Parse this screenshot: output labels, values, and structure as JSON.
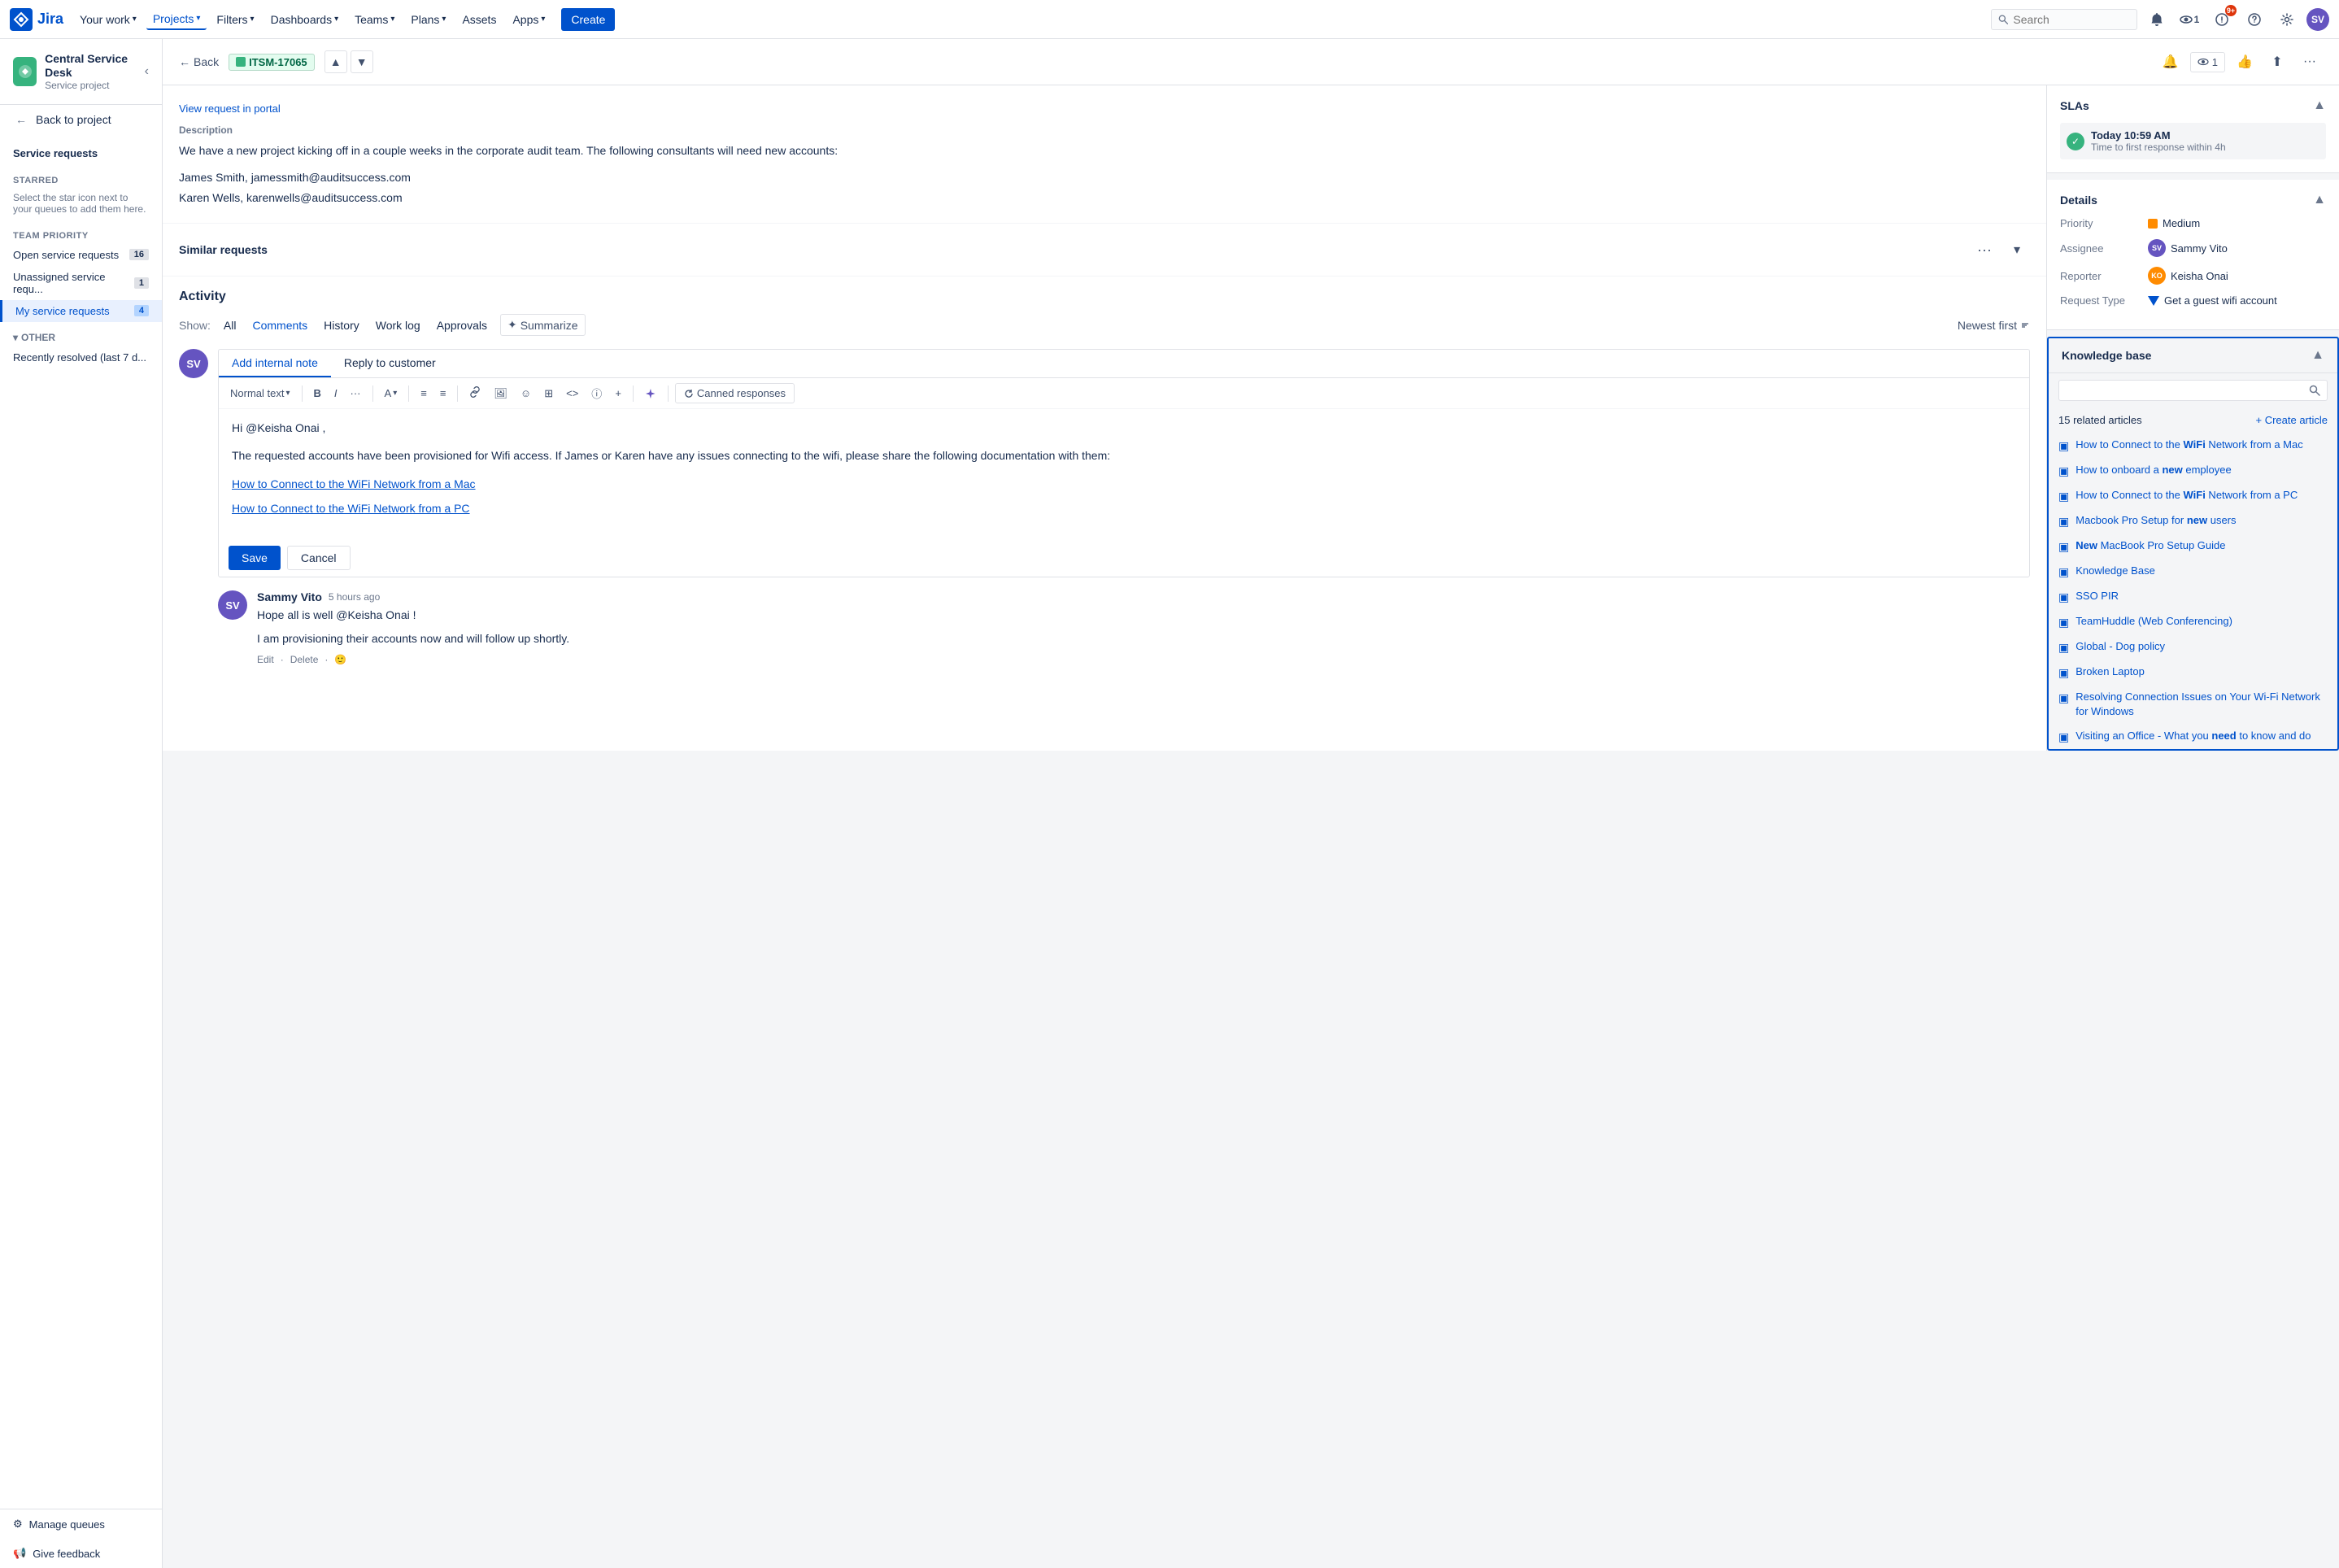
{
  "topNav": {
    "logo": "J",
    "logoText": "Jira",
    "yourWork": "Your work",
    "projects": "Projects",
    "filters": "Filters",
    "dashboards": "Dashboards",
    "teams": "Teams",
    "plans": "Plans",
    "assets": "Assets",
    "apps": "Apps",
    "createBtn": "Create",
    "search": {
      "placeholder": "Search"
    },
    "notifCount": "9+"
  },
  "sidebar": {
    "projectName": "Central Service Desk",
    "projectType": "Service project",
    "backToProject": "Back to project",
    "serviceRequests": "Service requests",
    "starred": "STARRED",
    "starredHint": "Select the star icon next to your queues to add them here.",
    "teamPriority": "TEAM PRIORITY",
    "queues": [
      {
        "label": "Open service requests",
        "count": "16"
      },
      {
        "label": "Unassigned service requ...",
        "count": "1"
      },
      {
        "label": "My service requests",
        "count": "4",
        "active": true
      }
    ],
    "other": "OTHER",
    "otherItems": [
      {
        "label": "Recently resolved (last 7 d..."
      }
    ],
    "bottom": [
      {
        "label": "Manage queues",
        "icon": "⚙"
      },
      {
        "label": "Give feedback",
        "icon": "📢"
      }
    ]
  },
  "ticketHeader": {
    "back": "Back",
    "ticketId": "ITSM-17065"
  },
  "description": {
    "viewPortal": "View request in portal",
    "label": "Description",
    "text1": "We have a new project kicking off in a couple weeks in the corporate audit team. The following consultants will need new accounts:",
    "consultant1": "James Smith, jamessmith@auditsuccess.com",
    "consultant2": "Karen Wells, karenwells@auditsuccess.com"
  },
  "similarRequests": {
    "title": "Similar requests"
  },
  "activity": {
    "title": "Activity",
    "showLabel": "Show:",
    "filters": [
      "All",
      "Comments",
      "History",
      "Work log",
      "Approvals"
    ],
    "activeFilter": "Comments",
    "summarize": "Summarize",
    "newestFirst": "Newest first"
  },
  "editor": {
    "tabs": [
      "Add internal note",
      "Reply to customer"
    ],
    "activeTab": "Add internal note",
    "toolbar": {
      "textStyle": "Normal text",
      "bold": "B",
      "italic": "I",
      "more": "···",
      "textColor": "A",
      "bulletList": "≡",
      "numberedList": "≡",
      "link": "🔗",
      "image": "🖼",
      "emoji": "☺",
      "table": "⊞",
      "code": "<>",
      "info": "ⓘ",
      "plus": "+",
      "aiSparkle": "✦",
      "cannedBtn": "Canned responses"
    },
    "content": {
      "greeting": "Hi @Keisha Onai ,",
      "body1": "The requested accounts have been provisioned for Wifi access. If James or Karen have any issues connecting to the wifi, please share the following documentation with them:",
      "link1": "How to Connect to the WiFi Network from a Mac",
      "link2": "How to Connect to the WiFi Network from a PC"
    },
    "saveBtn": "Save",
    "cancelBtn": "Cancel"
  },
  "pastComment": {
    "authorInitials": "SV",
    "author": "Sammy Vito",
    "time": "5 hours ago",
    "text1": "Hope all is well @Keisha Onai !",
    "text2": "I am provisioning their accounts now and will follow up shortly.",
    "actions": [
      "Edit",
      "·",
      "Delete",
      "·"
    ]
  },
  "rightPanel": {
    "slas": {
      "title": "SLAs",
      "item": {
        "time": "Today 10:59 AM",
        "label": "Time to first response within 4h"
      }
    },
    "details": {
      "title": "Details",
      "priority": {
        "label": "Priority",
        "value": "Medium"
      },
      "assignee": {
        "label": "Assignee",
        "value": "Sammy Vito",
        "initials": "SV"
      },
      "reporter": {
        "label": "Reporter",
        "value": "Keisha Onai",
        "initials": "KO"
      },
      "requestType": {
        "label": "Request Type",
        "value": "Get a guest wifi account"
      }
    },
    "knowledgeBase": {
      "title": "Knowledge base",
      "searchPlaceholder": "",
      "relatedCount": "15 related articles",
      "createBtn": "+ Create article",
      "articles": [
        {
          "text": "How to Connect to the ",
          "bold": "WiFi",
          "suffix": " Network from a Mac"
        },
        {
          "text": "How to onboard a ",
          "bold": "new",
          "suffix": " employee"
        },
        {
          "text": "How to Connect to the ",
          "bold": "WiFi",
          "suffix": " Network from a PC"
        },
        {
          "text": "Macbook Pro Setup for ",
          "bold": "new",
          "suffix": " users"
        },
        {
          "text": "",
          "bold": "New",
          "suffix": " MacBook Pro Setup Guide"
        },
        {
          "text": "Knowledge Base",
          "bold": "",
          "suffix": ""
        },
        {
          "text": "SSO PIR",
          "bold": "",
          "suffix": ""
        },
        {
          "text": "TeamHuddle (Web Conferencing)",
          "bold": "",
          "suffix": ""
        },
        {
          "text": "Global - Dog policy",
          "bold": "",
          "suffix": ""
        },
        {
          "text": "Broken Laptop",
          "bold": "",
          "suffix": ""
        },
        {
          "text": "Resolving Connection Issues on Your Wi-Fi Network for Windows",
          "bold": "",
          "suffix": ""
        },
        {
          "text": "Visiting an Office - What you ",
          "bold": "need",
          "suffix": " to know and do"
        }
      ]
    }
  }
}
